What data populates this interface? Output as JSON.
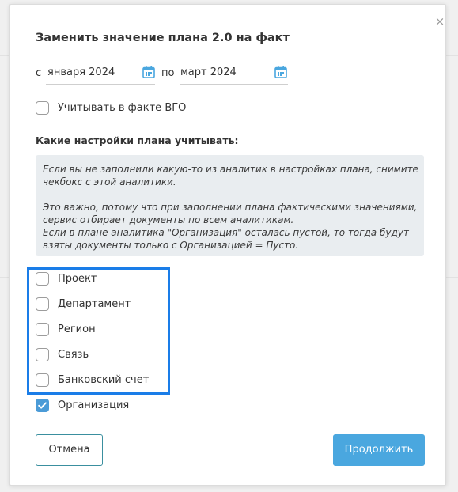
{
  "dialog": {
    "title": "Заменить значение плана 2.0 на факт",
    "close_symbol": "×",
    "period": {
      "from_label": "с",
      "from_value": "января 2024",
      "to_label": "по",
      "to_value": "март 2024"
    },
    "vgo_checkbox": {
      "label": "Учитывать в факте ВГО",
      "checked": false
    },
    "settings_title": "Какие настройки плана учитывать:",
    "info": {
      "paragraph1": "Если вы не заполнили какую-то из аналитик в настройках плана, снимите чекбокс с этой аналитики.",
      "paragraph2_line1": "Это важно, потому что при заполнении плана фактическими значениями, сервис отбирает документы по всем аналитикам.",
      "paragraph2_line2": "Если в плане аналитика \"Организация\" осталась пустой, то тогда будут взяты документы только с Организацией = Пусто."
    },
    "analytics": [
      {
        "label": "Проект",
        "checked": false
      },
      {
        "label": "Департамент",
        "checked": false
      },
      {
        "label": "Регион",
        "checked": false
      },
      {
        "label": "Связь",
        "checked": false
      },
      {
        "label": "Банковский счет",
        "checked": false
      },
      {
        "label": "Организация",
        "checked": true
      }
    ],
    "buttons": {
      "cancel_label": "Отмена",
      "continue_label": "Продолжить"
    }
  },
  "colors": {
    "accent": "#4aa7df",
    "checkbox_checked": "#4b9bd7",
    "highlight_frame": "#1a7de8",
    "info_bg": "#e9edf0"
  },
  "icons": {
    "date_picker": "calendar-icon",
    "close": "close-icon",
    "check": "checkmark-icon"
  }
}
